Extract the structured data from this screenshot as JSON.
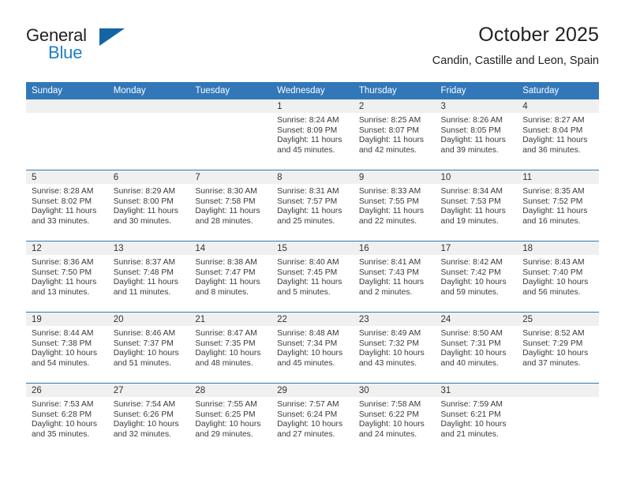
{
  "brand": {
    "name_line1": "General",
    "name_line2": "Blue",
    "triangle_color": "#1464a5",
    "blue_text_color": "#1f7fc4"
  },
  "header": {
    "title": "October 2025",
    "subtitle": "Candin, Castille and Leon, Spain"
  },
  "theme": {
    "header_row_bg": "#3277b8",
    "daynum_band_bg": "#f0f0f0",
    "row_separator": "#3277b8"
  },
  "weekday_headers": [
    "Sunday",
    "Monday",
    "Tuesday",
    "Wednesday",
    "Thursday",
    "Friday",
    "Saturday"
  ],
  "weeks": [
    [
      {
        "day": "",
        "sunrise": "",
        "sunset": "",
        "daylight_line1": "",
        "daylight_line2": "",
        "empty": true
      },
      {
        "day": "",
        "sunrise": "",
        "sunset": "",
        "daylight_line1": "",
        "daylight_line2": "",
        "empty": true
      },
      {
        "day": "",
        "sunrise": "",
        "sunset": "",
        "daylight_line1": "",
        "daylight_line2": "",
        "empty": true
      },
      {
        "day": "1",
        "sunrise": "Sunrise: 8:24 AM",
        "sunset": "Sunset: 8:09 PM",
        "daylight_line1": "Daylight: 11 hours",
        "daylight_line2": "and 45 minutes."
      },
      {
        "day": "2",
        "sunrise": "Sunrise: 8:25 AM",
        "sunset": "Sunset: 8:07 PM",
        "daylight_line1": "Daylight: 11 hours",
        "daylight_line2": "and 42 minutes."
      },
      {
        "day": "3",
        "sunrise": "Sunrise: 8:26 AM",
        "sunset": "Sunset: 8:05 PM",
        "daylight_line1": "Daylight: 11 hours",
        "daylight_line2": "and 39 minutes."
      },
      {
        "day": "4",
        "sunrise": "Sunrise: 8:27 AM",
        "sunset": "Sunset: 8:04 PM",
        "daylight_line1": "Daylight: 11 hours",
        "daylight_line2": "and 36 minutes."
      }
    ],
    [
      {
        "day": "5",
        "sunrise": "Sunrise: 8:28 AM",
        "sunset": "Sunset: 8:02 PM",
        "daylight_line1": "Daylight: 11 hours",
        "daylight_line2": "and 33 minutes."
      },
      {
        "day": "6",
        "sunrise": "Sunrise: 8:29 AM",
        "sunset": "Sunset: 8:00 PM",
        "daylight_line1": "Daylight: 11 hours",
        "daylight_line2": "and 30 minutes."
      },
      {
        "day": "7",
        "sunrise": "Sunrise: 8:30 AM",
        "sunset": "Sunset: 7:58 PM",
        "daylight_line1": "Daylight: 11 hours",
        "daylight_line2": "and 28 minutes."
      },
      {
        "day": "8",
        "sunrise": "Sunrise: 8:31 AM",
        "sunset": "Sunset: 7:57 PM",
        "daylight_line1": "Daylight: 11 hours",
        "daylight_line2": "and 25 minutes."
      },
      {
        "day": "9",
        "sunrise": "Sunrise: 8:33 AM",
        "sunset": "Sunset: 7:55 PM",
        "daylight_line1": "Daylight: 11 hours",
        "daylight_line2": "and 22 minutes."
      },
      {
        "day": "10",
        "sunrise": "Sunrise: 8:34 AM",
        "sunset": "Sunset: 7:53 PM",
        "daylight_line1": "Daylight: 11 hours",
        "daylight_line2": "and 19 minutes."
      },
      {
        "day": "11",
        "sunrise": "Sunrise: 8:35 AM",
        "sunset": "Sunset: 7:52 PM",
        "daylight_line1": "Daylight: 11 hours",
        "daylight_line2": "and 16 minutes."
      }
    ],
    [
      {
        "day": "12",
        "sunrise": "Sunrise: 8:36 AM",
        "sunset": "Sunset: 7:50 PM",
        "daylight_line1": "Daylight: 11 hours",
        "daylight_line2": "and 13 minutes."
      },
      {
        "day": "13",
        "sunrise": "Sunrise: 8:37 AM",
        "sunset": "Sunset: 7:48 PM",
        "daylight_line1": "Daylight: 11 hours",
        "daylight_line2": "and 11 minutes."
      },
      {
        "day": "14",
        "sunrise": "Sunrise: 8:38 AM",
        "sunset": "Sunset: 7:47 PM",
        "daylight_line1": "Daylight: 11 hours",
        "daylight_line2": "and 8 minutes."
      },
      {
        "day": "15",
        "sunrise": "Sunrise: 8:40 AM",
        "sunset": "Sunset: 7:45 PM",
        "daylight_line1": "Daylight: 11 hours",
        "daylight_line2": "and 5 minutes."
      },
      {
        "day": "16",
        "sunrise": "Sunrise: 8:41 AM",
        "sunset": "Sunset: 7:43 PM",
        "daylight_line1": "Daylight: 11 hours",
        "daylight_line2": "and 2 minutes."
      },
      {
        "day": "17",
        "sunrise": "Sunrise: 8:42 AM",
        "sunset": "Sunset: 7:42 PM",
        "daylight_line1": "Daylight: 10 hours",
        "daylight_line2": "and 59 minutes."
      },
      {
        "day": "18",
        "sunrise": "Sunrise: 8:43 AM",
        "sunset": "Sunset: 7:40 PM",
        "daylight_line1": "Daylight: 10 hours",
        "daylight_line2": "and 56 minutes."
      }
    ],
    [
      {
        "day": "19",
        "sunrise": "Sunrise: 8:44 AM",
        "sunset": "Sunset: 7:38 PM",
        "daylight_line1": "Daylight: 10 hours",
        "daylight_line2": "and 54 minutes."
      },
      {
        "day": "20",
        "sunrise": "Sunrise: 8:46 AM",
        "sunset": "Sunset: 7:37 PM",
        "daylight_line1": "Daylight: 10 hours",
        "daylight_line2": "and 51 minutes."
      },
      {
        "day": "21",
        "sunrise": "Sunrise: 8:47 AM",
        "sunset": "Sunset: 7:35 PM",
        "daylight_line1": "Daylight: 10 hours",
        "daylight_line2": "and 48 minutes."
      },
      {
        "day": "22",
        "sunrise": "Sunrise: 8:48 AM",
        "sunset": "Sunset: 7:34 PM",
        "daylight_line1": "Daylight: 10 hours",
        "daylight_line2": "and 45 minutes."
      },
      {
        "day": "23",
        "sunrise": "Sunrise: 8:49 AM",
        "sunset": "Sunset: 7:32 PM",
        "daylight_line1": "Daylight: 10 hours",
        "daylight_line2": "and 43 minutes."
      },
      {
        "day": "24",
        "sunrise": "Sunrise: 8:50 AM",
        "sunset": "Sunset: 7:31 PM",
        "daylight_line1": "Daylight: 10 hours",
        "daylight_line2": "and 40 minutes."
      },
      {
        "day": "25",
        "sunrise": "Sunrise: 8:52 AM",
        "sunset": "Sunset: 7:29 PM",
        "daylight_line1": "Daylight: 10 hours",
        "daylight_line2": "and 37 minutes."
      }
    ],
    [
      {
        "day": "26",
        "sunrise": "Sunrise: 7:53 AM",
        "sunset": "Sunset: 6:28 PM",
        "daylight_line1": "Daylight: 10 hours",
        "daylight_line2": "and 35 minutes."
      },
      {
        "day": "27",
        "sunrise": "Sunrise: 7:54 AM",
        "sunset": "Sunset: 6:26 PM",
        "daylight_line1": "Daylight: 10 hours",
        "daylight_line2": "and 32 minutes."
      },
      {
        "day": "28",
        "sunrise": "Sunrise: 7:55 AM",
        "sunset": "Sunset: 6:25 PM",
        "daylight_line1": "Daylight: 10 hours",
        "daylight_line2": "and 29 minutes."
      },
      {
        "day": "29",
        "sunrise": "Sunrise: 7:57 AM",
        "sunset": "Sunset: 6:24 PM",
        "daylight_line1": "Daylight: 10 hours",
        "daylight_line2": "and 27 minutes."
      },
      {
        "day": "30",
        "sunrise": "Sunrise: 7:58 AM",
        "sunset": "Sunset: 6:22 PM",
        "daylight_line1": "Daylight: 10 hours",
        "daylight_line2": "and 24 minutes."
      },
      {
        "day": "31",
        "sunrise": "Sunrise: 7:59 AM",
        "sunset": "Sunset: 6:21 PM",
        "daylight_line1": "Daylight: 10 hours",
        "daylight_line2": "and 21 minutes."
      },
      {
        "day": "",
        "sunrise": "",
        "sunset": "",
        "daylight_line1": "",
        "daylight_line2": "",
        "empty": true
      }
    ]
  ]
}
